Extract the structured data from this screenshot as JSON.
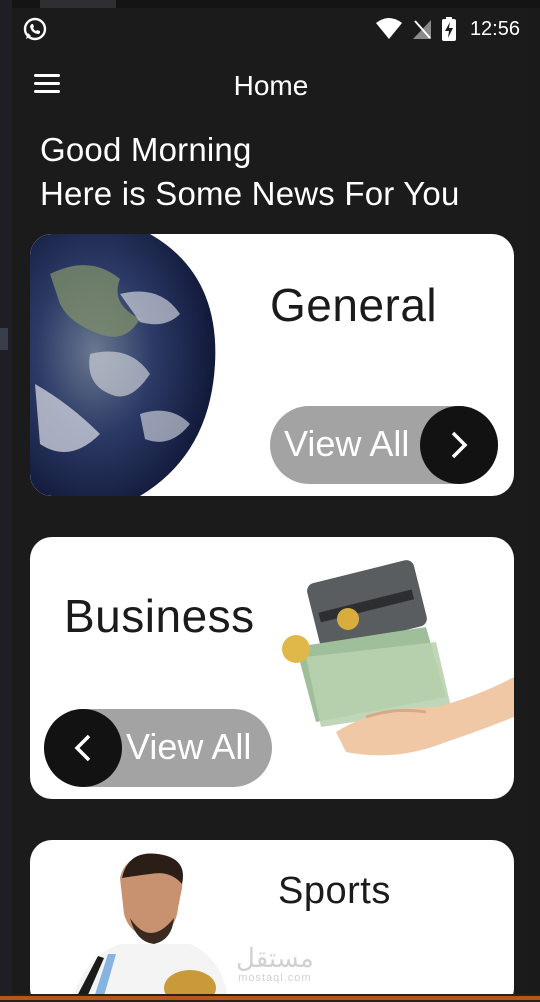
{
  "status_bar": {
    "time": "12:56",
    "icons": [
      "whatsapp-icon",
      "wifi-icon",
      "no-signal-icon",
      "battery-charging-icon"
    ]
  },
  "app_bar": {
    "title": "Home",
    "menu_icon": "menu-icon"
  },
  "greeting": {
    "line1": "Good Morning",
    "line2": "Here is Some News For You"
  },
  "cards": [
    {
      "title": "General",
      "button_label": "View All",
      "arrow": "chevron-right-icon",
      "image": "earth-image"
    },
    {
      "title": "Business",
      "button_label": "View All",
      "arrow": "chevron-left-icon",
      "image": "money-hand-image"
    },
    {
      "title": "Sports",
      "image": "football-player-image"
    }
  ],
  "watermark": {
    "arabic": "مستقل",
    "latin": "mostaql.com"
  },
  "colors": {
    "background": "#1b1b1b",
    "card": "#ffffff",
    "pill": "#a3a3a3",
    "circle": "#121212"
  }
}
